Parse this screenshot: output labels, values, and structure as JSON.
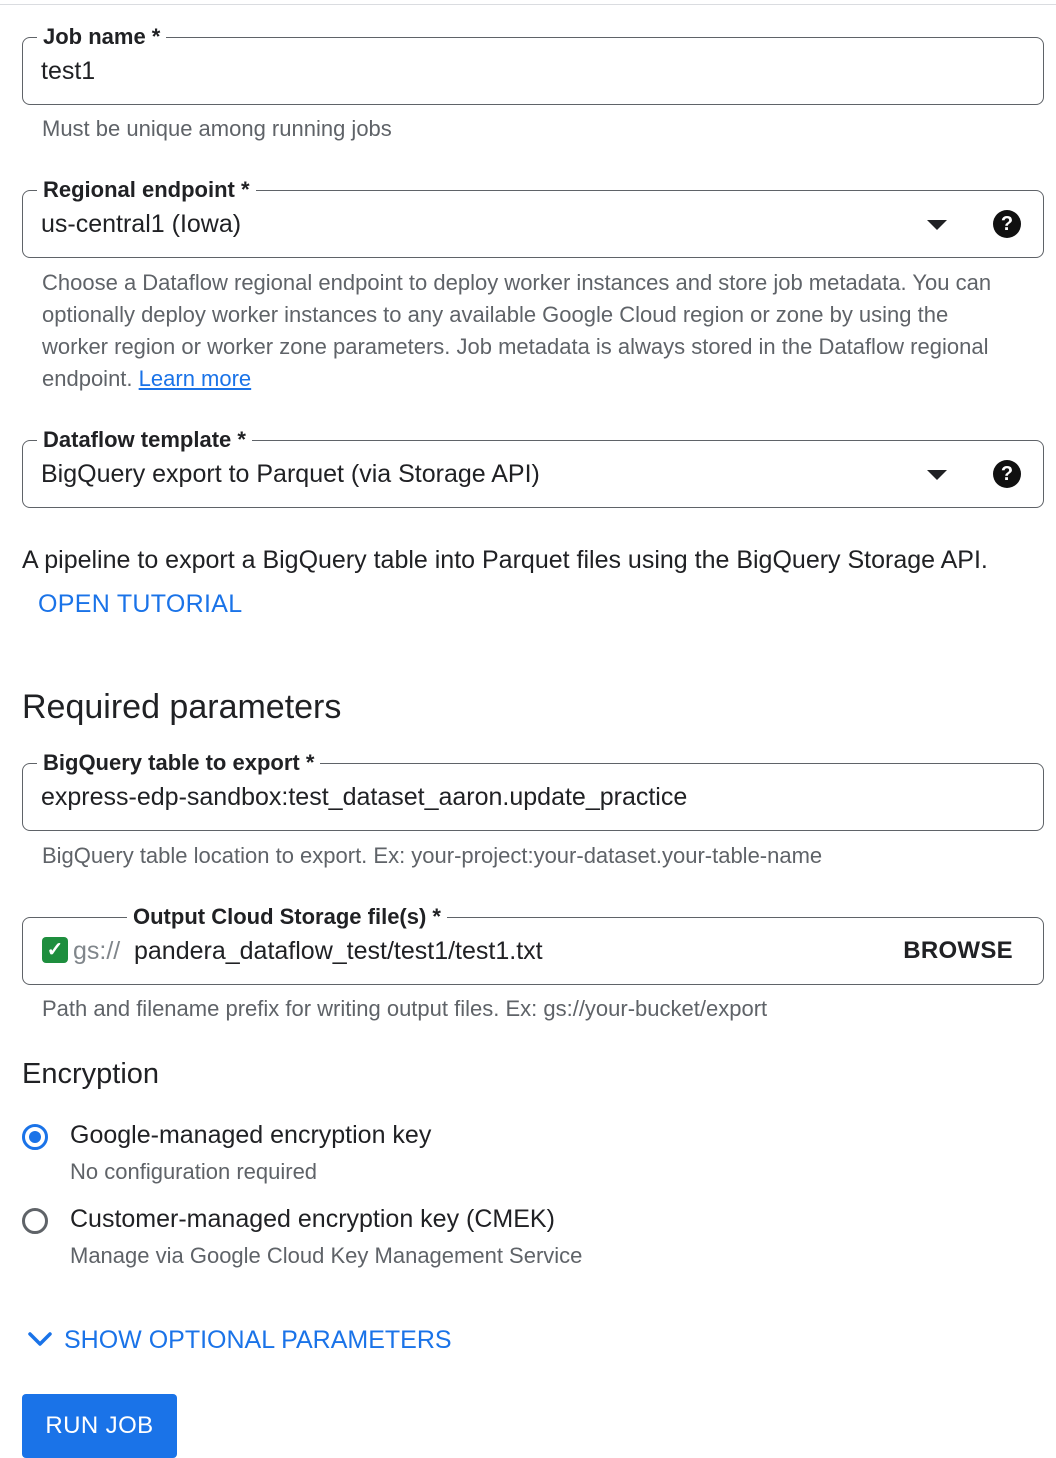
{
  "job_name": {
    "label": "Job name *",
    "value": "test1",
    "hint": "Must be unique among running jobs"
  },
  "regional_endpoint": {
    "label": "Regional endpoint *",
    "value": "us-central1 (Iowa)",
    "hint": "Choose a Dataflow regional endpoint to deploy worker instances and store job metadata. You can optionally deploy worker instances to any available Google Cloud region or zone by using the worker region or worker zone parameters. Job metadata is always stored in the Dataflow regional endpoint.",
    "learn_more": "Learn more"
  },
  "dataflow_template": {
    "label": "Dataflow template *",
    "value": "BigQuery export to Parquet (via Storage API)"
  },
  "template_description": "A pipeline to export a BigQuery table into Parquet files using the BigQuery Storage API.",
  "open_tutorial": "OPEN TUTORIAL",
  "required_parameters_title": "Required parameters",
  "bigquery_table": {
    "label": "BigQuery table to export *",
    "value": "express-edp-sandbox:test_dataset_aaron.update_practice",
    "hint": "BigQuery table location to export. Ex: your-project:your-dataset.your-table-name"
  },
  "output_storage": {
    "label": "Output Cloud Storage file(s) *",
    "prefix": "gs://",
    "value": "pandera_dataflow_test/test1/test1.txt",
    "browse": "BROWSE",
    "hint": "Path and filename prefix for writing output files. Ex: gs://your-bucket/export"
  },
  "encryption": {
    "title": "Encryption",
    "options": [
      {
        "label": "Google-managed encryption key",
        "sub": "No configuration required",
        "selected": true
      },
      {
        "label": "Customer-managed encryption key (CMEK)",
        "sub": "Manage via Google Cloud Key Management Service",
        "selected": false
      }
    ]
  },
  "show_optional": "SHOW OPTIONAL PARAMETERS",
  "run_job": "RUN JOB",
  "colors": {
    "accent": "#1a73e8",
    "check_green": "#1e8e3e",
    "outline": "#5f6368",
    "hint_text": "#5f6368"
  },
  "icons": [
    "dropdown-arrow-icon",
    "help-icon",
    "checkbox-checked-icon",
    "chevron-down-icon"
  ]
}
